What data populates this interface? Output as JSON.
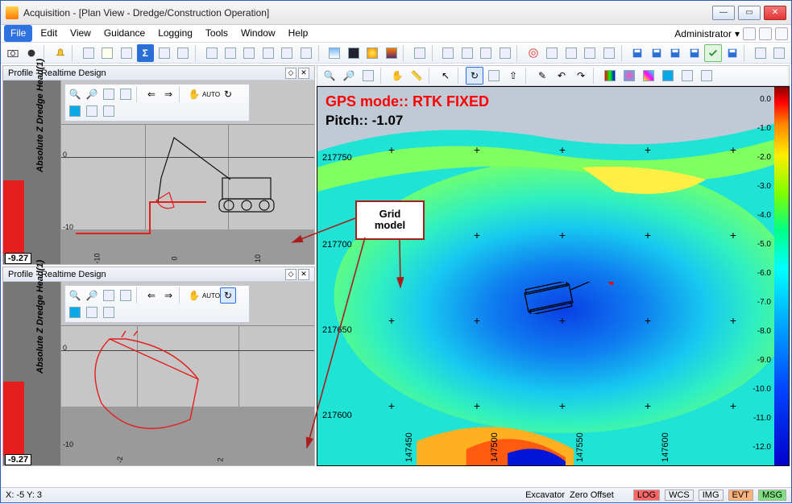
{
  "window": {
    "title": "Acquisition - [Plan View - Dredge/Construction Operation]"
  },
  "menu": {
    "items": [
      "File",
      "Edit",
      "View",
      "Guidance",
      "Logging",
      "Tools",
      "Window",
      "Help"
    ],
    "admin_label": "Administrator"
  },
  "panels": {
    "profile_title": "Profile - Realtime Design",
    "axis_label": "Absolute Z Dredge Head(1)",
    "gauge_value": "-9.27"
  },
  "plan": {
    "gps_text": "GPS mode:: RTK FIXED",
    "pitch_text": "Pitch:: -1.07",
    "y_ticks": [
      "217750",
      "217700",
      "217650",
      "217600"
    ],
    "x_ticks": [
      "147450",
      "147500",
      "147550",
      "147600"
    ],
    "scale_ticks": [
      "0.0",
      "-1.0",
      "-2.0",
      "-3.0",
      "-4.0",
      "-5.0",
      "-6.0",
      "-7.0",
      "-8.0",
      "-9.0",
      "-10.0",
      "-11.0",
      "-12.0"
    ]
  },
  "callout": {
    "line1": "Grid",
    "line2": "model"
  },
  "status": {
    "coords": "X: -5  Y: 3",
    "mode": "Excavator",
    "offset": "Zero Offset",
    "chips": [
      "LOG",
      "WCS",
      "IMG",
      "EVT",
      "MSG"
    ]
  },
  "profile_grid": {
    "v_ticks_top": [
      "-10",
      "0",
      "10"
    ],
    "h_ticks_top": [
      "0",
      "-10"
    ],
    "v_ticks_bot": [
      "-2",
      "2"
    ],
    "h_ticks_bot": [
      "0",
      "-10"
    ]
  }
}
